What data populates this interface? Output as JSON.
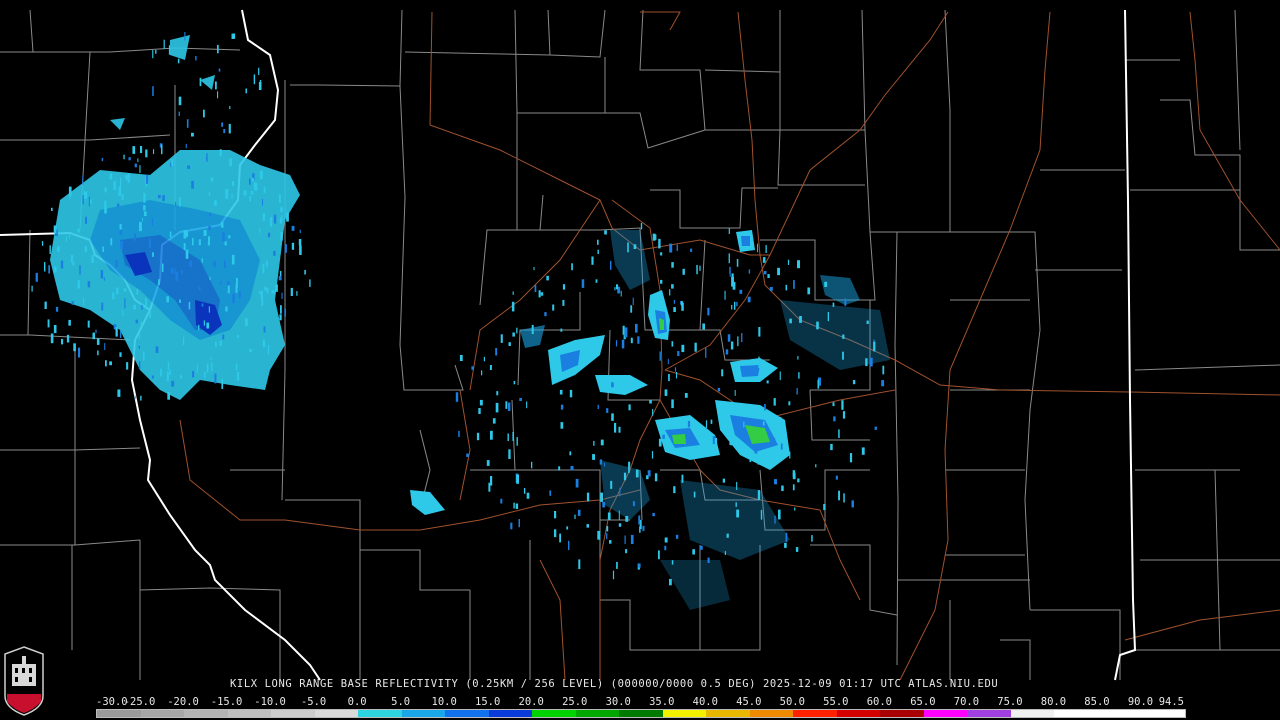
{
  "caption": "KILX LONG RANGE BASE REFLECTIVITY (0.25KM / 256 LEVEL) (000000/0000 0.5 DEG) 2025-12-09 01:17 UTC  ATLAS.NIU.EDU",
  "logo": {
    "text": "NIU",
    "color": "#c8102e"
  },
  "legend": {
    "labels": [
      "-30.0",
      "-25.0",
      "-20.0",
      "-15.0",
      "-10.0",
      "-5.0",
      "0.0",
      "5.0",
      "10.0",
      "15.0",
      "20.0",
      "25.0",
      "30.0",
      "35.0",
      "40.0",
      "45.0",
      "50.0",
      "55.0",
      "60.0",
      "65.0",
      "70.0",
      "75.0",
      "80.0",
      "85.0",
      "90.0",
      "94.5"
    ],
    "colors": [
      "#9a9a9a",
      "#a6a6a6",
      "#b3b3b3",
      "#bfbfbf",
      "#cccccc",
      "#d9d9d9",
      "#2ed3e0",
      "#1aa7e8",
      "#1272ee",
      "#0a3ad8",
      "#00d400",
      "#00a800",
      "#007a00",
      "#f2f200",
      "#e8b800",
      "#ee8a00",
      "#ff2000",
      "#d40000",
      "#a80000",
      "#ff00ff",
      "#a040e0",
      "#f0f0f0",
      "#ffffff",
      "#ffffff",
      "#ffffff"
    ]
  },
  "colors": {
    "background": "#000000",
    "county_lines": "#8a8a8a",
    "state_lines": "#ffffff",
    "highways": "#a0522d",
    "echo_light": "#2ec8e8",
    "echo_medium": "#1a7fe0",
    "echo_strong": "#0a3ad0",
    "echo_green": "#33cc44"
  }
}
